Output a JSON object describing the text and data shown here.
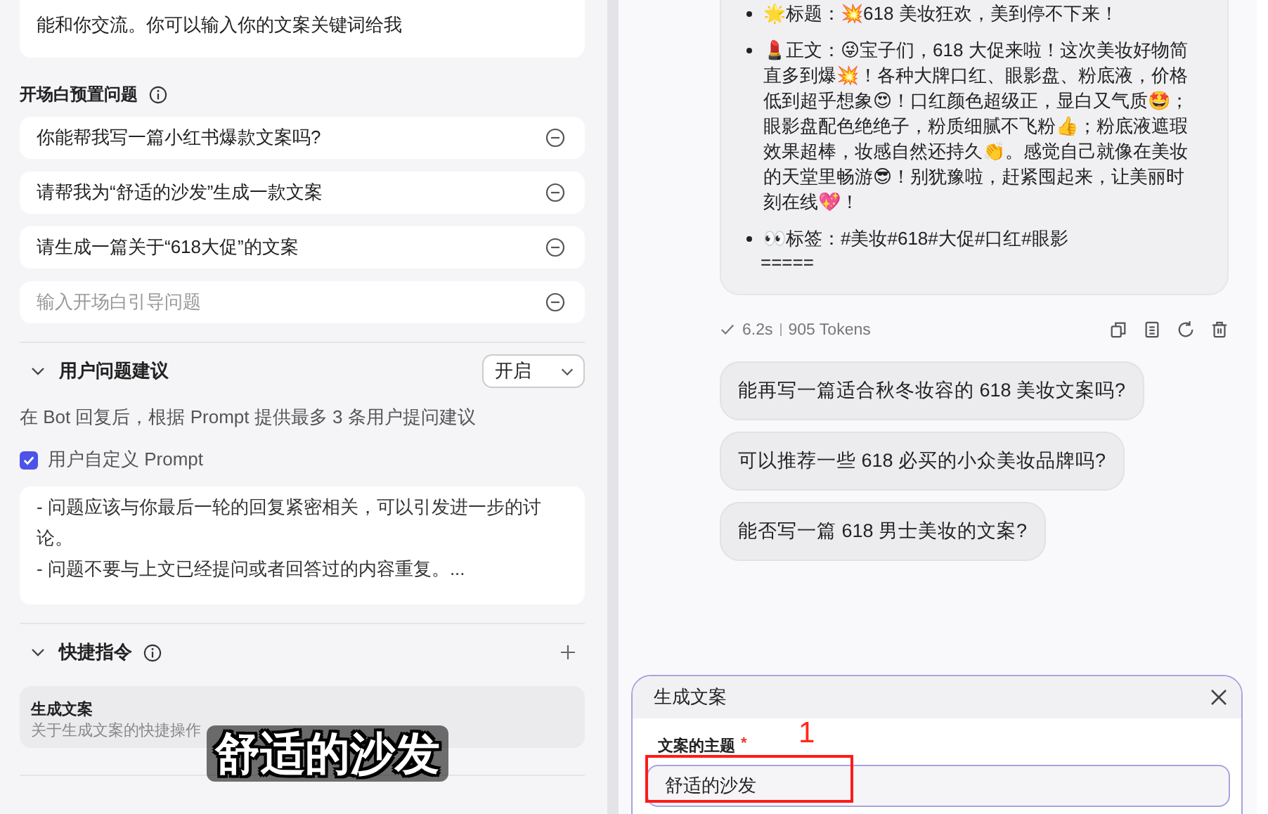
{
  "opening_text": "能和你交流。你可以输入你的文案关键词给我",
  "preset_questions": {
    "title": "开场白预置问题",
    "items": [
      {
        "text": "你能帮我写一篇小红书爆款文案吗?",
        "kind": "value"
      },
      {
        "text": "请帮我为“舒适的沙发”生成一款文案",
        "kind": "value"
      },
      {
        "text": "请生成一篇关于“618大促”的文案",
        "kind": "value"
      },
      {
        "text": "输入开场白引导问题",
        "kind": "placeholder"
      }
    ]
  },
  "suggestions": {
    "title": "用户问题建议",
    "expanded": true,
    "select_value": "开启",
    "description": "在 Bot 回复后，根据 Prompt 提供最多 3 条用户提问建议",
    "custom_prompt": {
      "label": "用户自定义 Prompt",
      "checked": true
    },
    "prompt_lines": [
      "- 问题应该与你最后一轮的回复紧密相关，可以引发进一步的讨论。",
      "- 问题不要与上文已经提问或者回答过的内容重复。..."
    ]
  },
  "shortcuts": {
    "title": "快捷指令",
    "expanded": true,
    "items": [
      {
        "name": "生成文案",
        "description": "关于生成文案的快捷操作"
      }
    ]
  },
  "message": {
    "bullets": [
      "🌟标题：💥618 美妆狂欢，美到停不下来！",
      "💄正文：😜宝子们，618 大促来啦！这次美妆好物简直多到爆💥！各种大牌口红、眼影盘、粉底液，价格低到超乎想象😍！口红颜色超级正，显白又气质🤩；眼影盘配色绝绝子，粉质细腻不飞粉👍；粉底液遮瑕效果超棒，妆感自然还持久👏。感觉自己就像在美妆的天堂里畅游😎！别犹豫啦，赶紧囤起来，让美丽时刻在线💖！",
      "👀标签：#美妆#618#大促#口红#眼影"
    ],
    "trailing": "=====",
    "duration": "6.2s",
    "tokens": "905 Tokens"
  },
  "suggested_questions": [
    "能再写一篇适合秋冬妆容的 618 美妆文案吗?",
    "可以推荐一些 618 必买的小众美妆品牌吗?",
    "能否写一篇 618 男士美妆的文案?"
  ],
  "form": {
    "title": "生成文案",
    "field_label": "文案的主题",
    "required_mark": "*",
    "value": "舒适的沙发"
  },
  "subtitle": "舒适的沙发",
  "annotation": {
    "label": "1"
  }
}
